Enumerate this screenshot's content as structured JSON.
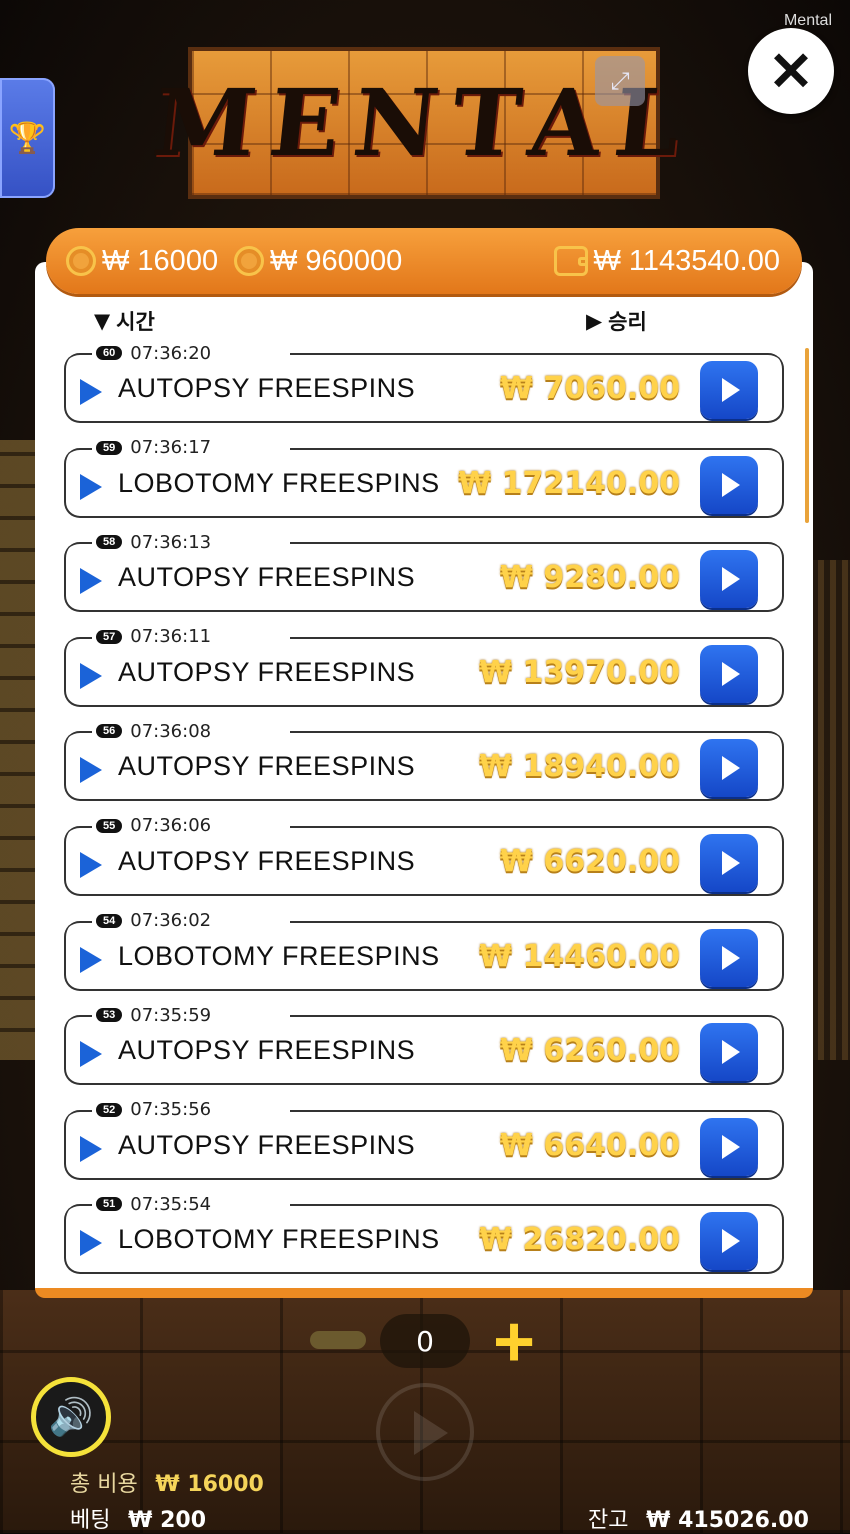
{
  "watermark": "Mental",
  "logo_text": "MENTAL",
  "stats": {
    "currency": "₩",
    "total_bet": "₩ 16000",
    "max_win": "₩ 960000",
    "balance_total": "₩ 1143540.00"
  },
  "headers": {
    "time": "시간",
    "win": "승리"
  },
  "history": [
    {
      "round": "60",
      "time": "07:36:20",
      "feature": "AUTOPSY FREESPINS",
      "win": "₩ 7060.00"
    },
    {
      "round": "59",
      "time": "07:36:17",
      "feature": "LOBOTOMY FREESPINS",
      "win": "₩ 172140.00"
    },
    {
      "round": "58",
      "time": "07:36:13",
      "feature": "AUTOPSY FREESPINS",
      "win": "₩ 9280.00"
    },
    {
      "round": "57",
      "time": "07:36:11",
      "feature": "AUTOPSY FREESPINS",
      "win": "₩ 13970.00"
    },
    {
      "round": "56",
      "time": "07:36:08",
      "feature": "AUTOPSY FREESPINS",
      "win": "₩ 18940.00"
    },
    {
      "round": "55",
      "time": "07:36:06",
      "feature": "AUTOPSY FREESPINS",
      "win": "₩ 6620.00"
    },
    {
      "round": "54",
      "time": "07:36:02",
      "feature": "LOBOTOMY FREESPINS",
      "win": "₩ 14460.00"
    },
    {
      "round": "53",
      "time": "07:35:59",
      "feature": "AUTOPSY FREESPINS",
      "win": "₩ 6260.00"
    },
    {
      "round": "52",
      "time": "07:35:56",
      "feature": "AUTOPSY FREESPINS",
      "win": "₩ 6640.00"
    },
    {
      "round": "51",
      "time": "07:35:54",
      "feature": "LOBOTOMY FREESPINS",
      "win": "₩ 26820.00"
    }
  ],
  "controls": {
    "bet_count": "0",
    "minus_icon": "minus-icon",
    "plus_icon": "plus-icon",
    "plus_glyph": "+",
    "sound_icon": "speaker-icon",
    "spin_icon": "play-icon"
  },
  "footer": {
    "total_cost_label": "총 비용",
    "total_cost_value": "₩ 16000",
    "bet_label": "베팅",
    "bet_value": "₩ 200",
    "balance_label": "잔고",
    "balance_value": "₩ 415026.00"
  },
  "colors": {
    "accent_orange": "#ec8a22",
    "play_blue": "#1b63d8",
    "win_gold": "#ffd24a",
    "sound_yellow": "#f5e23a"
  }
}
